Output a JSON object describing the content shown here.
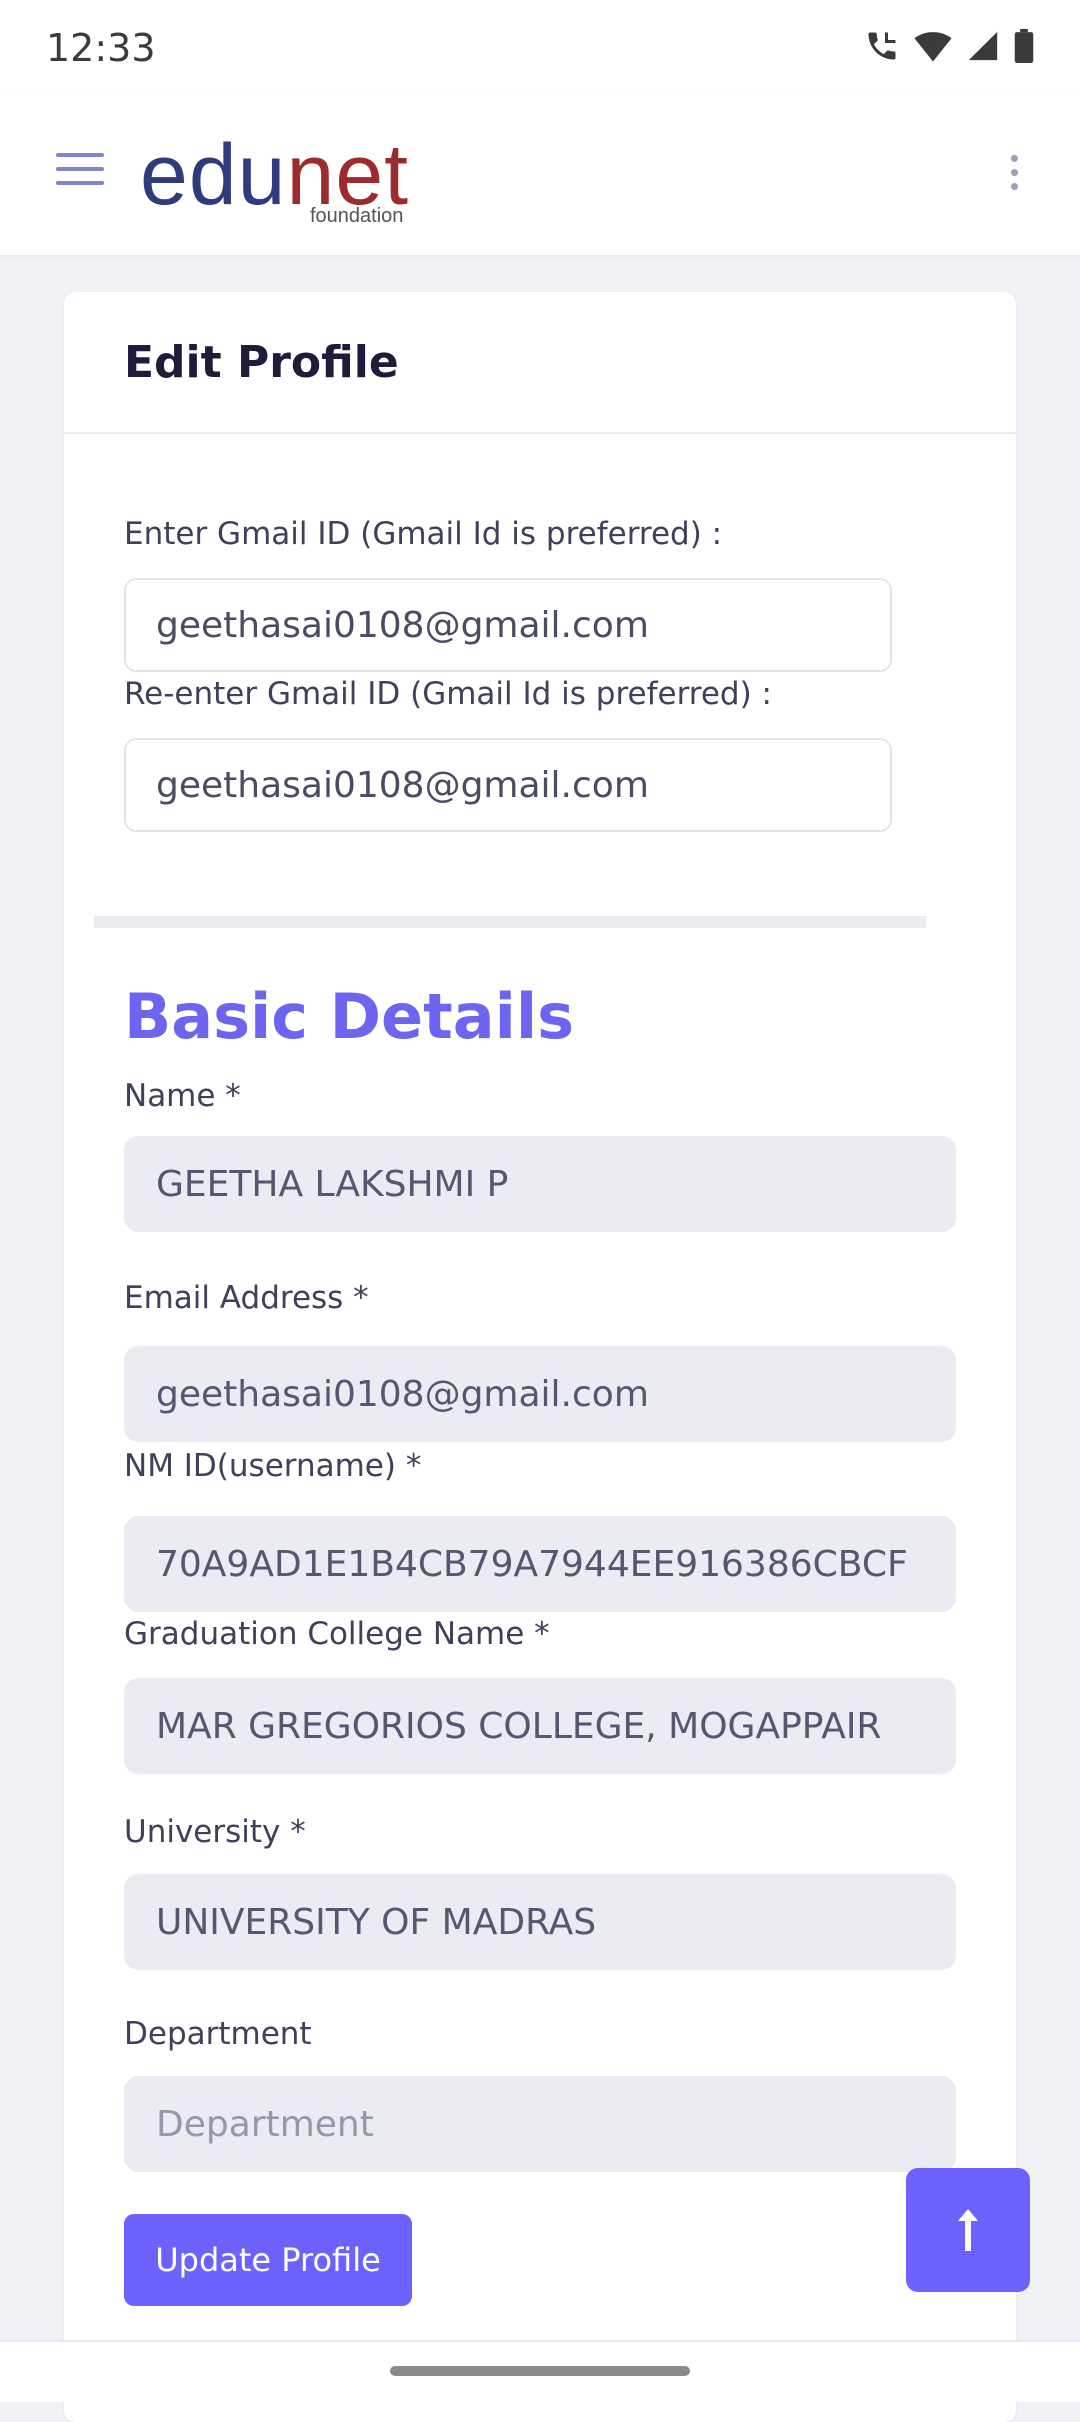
{
  "status_bar": {
    "time": "12:33"
  },
  "app_bar": {
    "logo_main_left": "edu",
    "logo_main_right": "net",
    "logo_sub": "foundation"
  },
  "page": {
    "title": "Edit Profile"
  },
  "gmail": {
    "enter_label": "Enter Gmail ID (Gmail Id is preferred) :",
    "enter_value": "geethasai0108@gmail.com",
    "reenter_label": "Re-enter Gmail ID (Gmail Id is preferred) :",
    "reenter_value": "geethasai0108@gmail.com"
  },
  "basic_details": {
    "title": "Basic Details",
    "name_label": "Name *",
    "name_value": "GEETHA LAKSHMI P",
    "email_label": "Email Address *",
    "email_value": "geethasai0108@gmail.com",
    "nmid_label": "NM ID(username) *",
    "nmid_value": "70A9AD1E1B4CB79A7944EE916386CBCF",
    "college_label": "Graduation College Name *",
    "college_value": "MAR GREGORIOS COLLEGE, MOGAPPAIR",
    "university_label": "University *",
    "university_value": "UNIVERSITY OF MADRAS",
    "department_label": "Department",
    "department_placeholder": "Department"
  },
  "actions": {
    "update_label": "Update Profile"
  },
  "colors": {
    "accent": "#6c63ff",
    "section_title": "#6c65f0",
    "logo_blue": "#2f3b7a",
    "logo_red": "#9c2b2b"
  },
  "icons": {
    "menu": "hamburger-icon",
    "more": "kebab-icon",
    "scroll_top": "arrow-up-icon",
    "status": [
      "phone-call-icon",
      "wifi-icon",
      "signal-icon",
      "battery-icon"
    ]
  }
}
